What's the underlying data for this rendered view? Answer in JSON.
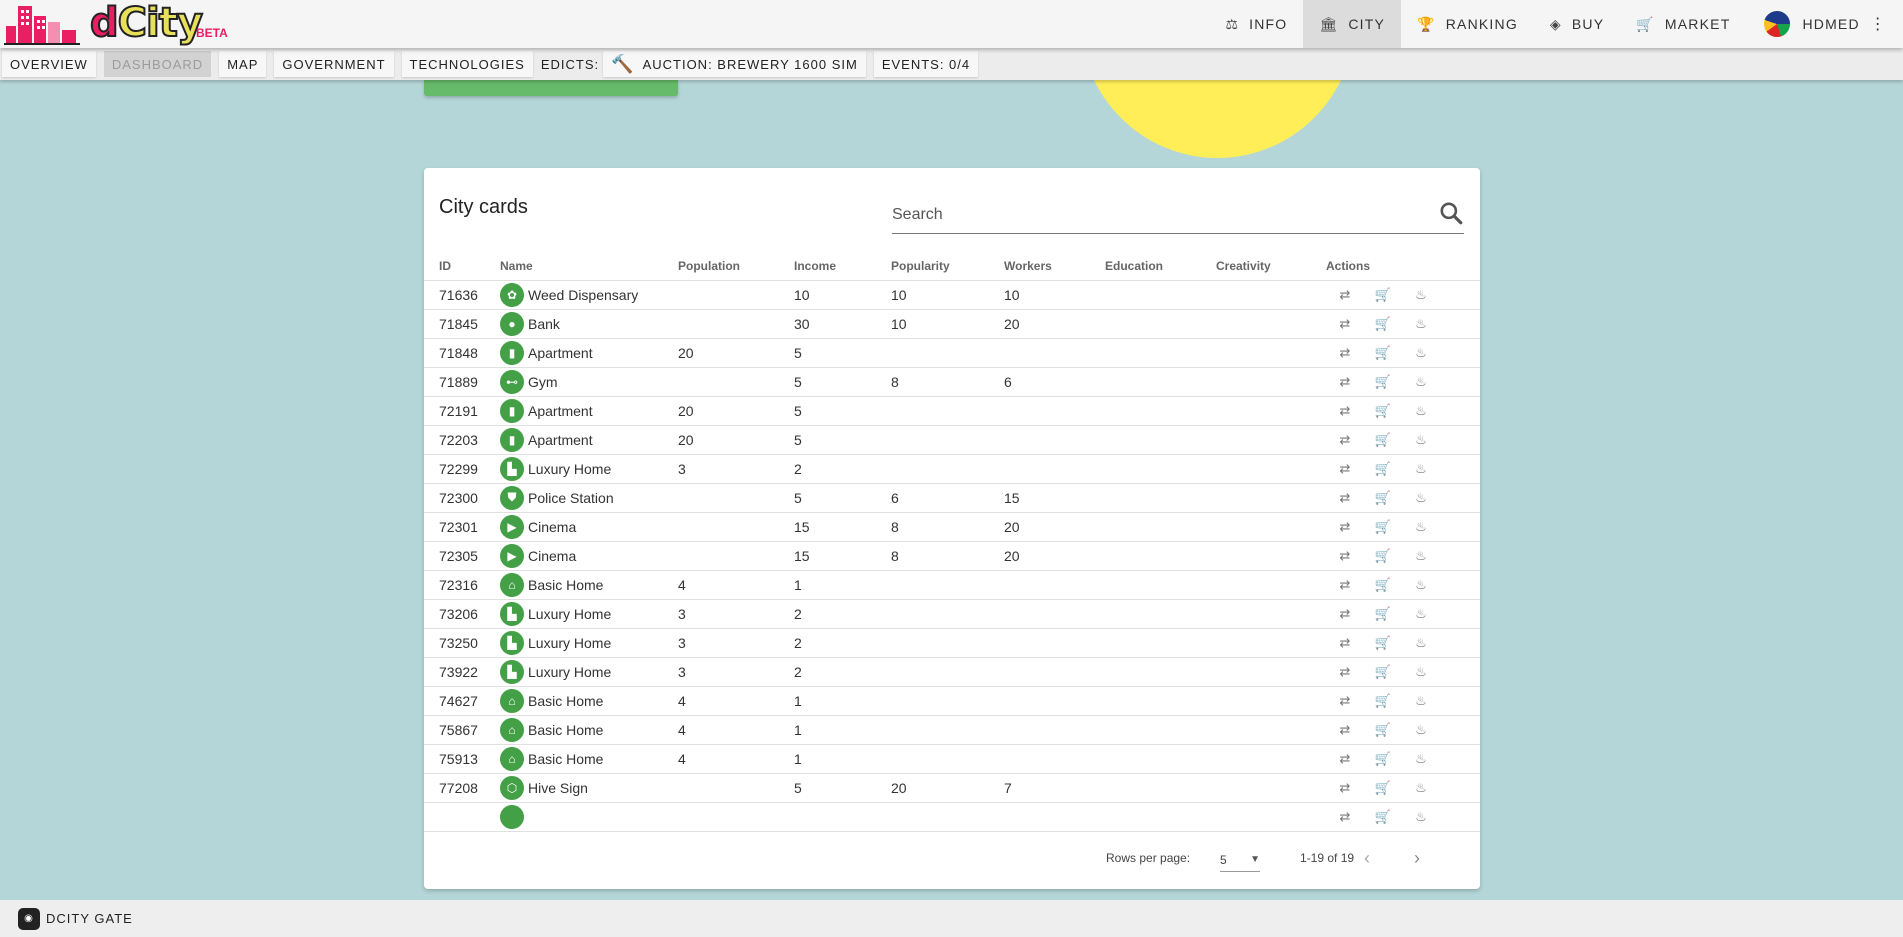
{
  "header": {
    "logo_text_d": "d",
    "logo_text_city": "City",
    "beta": "BETA",
    "nav": [
      {
        "label": "INFO",
        "icon": "scale-icon"
      },
      {
        "label": "CITY",
        "icon": "city-icon"
      },
      {
        "label": "RANKING",
        "icon": "trophy-icon"
      },
      {
        "label": "BUY",
        "icon": "layers-icon"
      },
      {
        "label": "MARKET",
        "icon": "cart-icon"
      }
    ],
    "user": "HDMED"
  },
  "subnav": {
    "overview": "OVERVIEW",
    "dashboard": "DASHBOARD",
    "map": "MAP",
    "government": "GOVERNMENT",
    "technologies": "TECHNOLOGIES",
    "edicts": "EDICTS:",
    "auction": "AUCTION: BREWERY 1600 SIM",
    "events": "EVENTS: 0/4"
  },
  "card": {
    "title": "City cards",
    "search_placeholder": "Search",
    "columns": [
      "ID",
      "Name",
      "Population",
      "Income",
      "Popularity",
      "Workers",
      "Education",
      "Creativity",
      "Actions"
    ],
    "rows": [
      {
        "id": "71636",
        "name": "Weed Dispensary",
        "icon": "leaf-icon",
        "population": "",
        "income": "10",
        "popularity": "10",
        "workers": "10",
        "education": "",
        "creativity": ""
      },
      {
        "id": "71845",
        "name": "Bank",
        "icon": "piggy-bank-icon",
        "population": "",
        "income": "30",
        "popularity": "10",
        "workers": "20",
        "education": "",
        "creativity": ""
      },
      {
        "id": "71848",
        "name": "Apartment",
        "icon": "building-icon",
        "population": "20",
        "income": "5",
        "popularity": "",
        "workers": "",
        "education": "",
        "creativity": ""
      },
      {
        "id": "71889",
        "name": "Gym",
        "icon": "dumbbell-icon",
        "population": "",
        "income": "5",
        "popularity": "8",
        "workers": "6",
        "education": "",
        "creativity": ""
      },
      {
        "id": "72191",
        "name": "Apartment",
        "icon": "building-icon",
        "population": "20",
        "income": "5",
        "popularity": "",
        "workers": "",
        "education": "",
        "creativity": ""
      },
      {
        "id": "72203",
        "name": "Apartment",
        "icon": "building-icon",
        "population": "20",
        "income": "5",
        "popularity": "",
        "workers": "",
        "education": "",
        "creativity": ""
      },
      {
        "id": "72299",
        "name": "Luxury Home",
        "icon": "villa-icon",
        "population": "3",
        "income": "2",
        "popularity": "",
        "workers": "",
        "education": "",
        "creativity": ""
      },
      {
        "id": "72300",
        "name": "Police Station",
        "icon": "badge-icon",
        "population": "",
        "income": "5",
        "popularity": "6",
        "workers": "15",
        "education": "",
        "creativity": ""
      },
      {
        "id": "72301",
        "name": "Cinema",
        "icon": "camera-icon",
        "population": "",
        "income": "15",
        "popularity": "8",
        "workers": "20",
        "education": "",
        "creativity": ""
      },
      {
        "id": "72305",
        "name": "Cinema",
        "icon": "camera-icon",
        "population": "",
        "income": "15",
        "popularity": "8",
        "workers": "20",
        "education": "",
        "creativity": ""
      },
      {
        "id": "72316",
        "name": "Basic Home",
        "icon": "home-icon",
        "population": "4",
        "income": "1",
        "popularity": "",
        "workers": "",
        "education": "",
        "creativity": ""
      },
      {
        "id": "73206",
        "name": "Luxury Home",
        "icon": "villa-icon",
        "population": "3",
        "income": "2",
        "popularity": "",
        "workers": "",
        "education": "",
        "creativity": ""
      },
      {
        "id": "73250",
        "name": "Luxury Home",
        "icon": "villa-icon",
        "population": "3",
        "income": "2",
        "popularity": "",
        "workers": "",
        "education": "",
        "creativity": ""
      },
      {
        "id": "73922",
        "name": "Luxury Home",
        "icon": "villa-icon",
        "population": "3",
        "income": "2",
        "popularity": "",
        "workers": "",
        "education": "",
        "creativity": ""
      },
      {
        "id": "74627",
        "name": "Basic Home",
        "icon": "home-icon",
        "population": "4",
        "income": "1",
        "popularity": "",
        "workers": "",
        "education": "",
        "creativity": ""
      },
      {
        "id": "75867",
        "name": "Basic Home",
        "icon": "home-icon",
        "population": "4",
        "income": "1",
        "popularity": "",
        "workers": "",
        "education": "",
        "creativity": ""
      },
      {
        "id": "75913",
        "name": "Basic Home",
        "icon": "home-icon",
        "population": "4",
        "income": "1",
        "popularity": "",
        "workers": "",
        "education": "",
        "creativity": ""
      },
      {
        "id": "77208",
        "name": "Hive Sign",
        "icon": "hive-icon",
        "population": "",
        "income": "5",
        "popularity": "20",
        "workers": "7",
        "education": "",
        "creativity": ""
      },
      {
        "id": "",
        "name": "",
        "icon": "blank-icon",
        "population": "",
        "income": "",
        "popularity": "",
        "workers": "",
        "education": "",
        "creativity": ""
      }
    ],
    "pagination": {
      "rows_per_page_label": "Rows per page:",
      "rows_per_page_value": "5",
      "range": "1-19 of 19"
    }
  },
  "footer": {
    "label": "DCITY GATE"
  },
  "colors": {
    "background": "#b4d6d8",
    "accent_green": "#43a047",
    "sun_yellow": "#ffee58",
    "brand_pink": "#e91e63"
  }
}
